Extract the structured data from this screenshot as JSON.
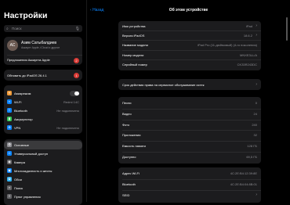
{
  "status_bar": {
    "left": "08:47  вт 20 апр.",
    "dots": "• • •",
    "right": "100%"
  },
  "sidebar": {
    "title": "Настройки",
    "search_placeholder": "Поиск",
    "profile": {
      "initials": "АС",
      "name": "Азим Сатыбалдиев",
      "subtitle": "Аккаунт Apple, iCloud и другое",
      "suggestions": "Предложения Аккаунта Apple",
      "badge": "2"
    },
    "update": {
      "label": "Обновить до iPadOS 26.4.1",
      "badge": "1"
    },
    "connectivity": [
      {
        "label": "Авиарежим",
        "value": "",
        "icon_color": "#f09a37",
        "icon": "airplane-icon",
        "glyph": "✈"
      },
      {
        "label": "Wi-Fi",
        "value": "Redmi 14C",
        "icon_color": "#0a84ff",
        "icon": "wifi-icon",
        "glyph": "≈"
      },
      {
        "label": "Bluetooth",
        "value": "Не подключено",
        "icon_color": "#0a84ff",
        "icon": "bluetooth-icon",
        "glyph": "ᛒ"
      },
      {
        "label": "Аккумулятор",
        "value": "",
        "icon_color": "#34c759",
        "icon": "battery-icon",
        "glyph": "▮"
      },
      {
        "label": "VPN",
        "value": "Не подключено",
        "icon_color": "#0a84ff",
        "icon": "vpn-icon",
        "glyph": "⊕"
      }
    ],
    "general": [
      {
        "label": "Основные",
        "icon_color": "#8e8e93",
        "icon": "gear-icon",
        "glyph": "⚙",
        "selected": true
      },
      {
        "label": "Универсальный доступ",
        "icon_color": "#0a84ff",
        "icon": "accessibility-icon",
        "glyph": "☺",
        "selected": false
      },
      {
        "label": "Камера",
        "icon_color": "#636366",
        "icon": "camera-icon",
        "glyph": "◉",
        "selected": false
      },
      {
        "label": "Многозадачность и жесты",
        "icon_color": "#0a84ff",
        "icon": "multitasking-icon",
        "glyph": "▣",
        "selected": false
      },
      {
        "label": "Обои",
        "icon_color": "#30b0f0",
        "icon": "wallpaper-icon",
        "glyph": "✿",
        "selected": false
      },
      {
        "label": "Поиск",
        "icon_color": "#636366",
        "icon": "search-icon",
        "glyph": "⌕",
        "selected": false
      },
      {
        "label": "Пункт управления",
        "icon_color": "#636366",
        "icon": "control-center-icon",
        "glyph": "≡",
        "selected": false
      }
    ]
  },
  "main": {
    "back_label": "Назад",
    "title": "Об этом устройстве",
    "info": [
      {
        "label": "Имя устройства",
        "value": "iPad",
        "chevron": true
      },
      {
        "label": "Версия iPadOS",
        "value": "18.6.2",
        "chevron": true
      },
      {
        "label": "Название модели",
        "value": "iPad Pro (11-дюймовый) (4-го поколения)",
        "chevron": false
      },
      {
        "label": "Номер модели",
        "value": "MNXE3LL/A",
        "chevron": false
      },
      {
        "label": "Серийный номер",
        "value": "CK33R243DC",
        "chevron": false
      }
    ],
    "coverage": {
      "label": "Срок действия права на сервисное обслуживание истек"
    },
    "stats": [
      {
        "label": "Песни",
        "value": "0"
      },
      {
        "label": "Видео",
        "value": "24"
      },
      {
        "label": "Фото",
        "value": "240"
      },
      {
        "label": "Приложения",
        "value": "32"
      },
      {
        "label": "Емкость памяти",
        "value": "128 ГБ"
      },
      {
        "label": "Доступно",
        "value": "69,5 ГБ"
      }
    ],
    "network": [
      {
        "label": "Адрес Wi-Fi",
        "value": "4C:2E:B4:12:39:8E"
      },
      {
        "label": "Bluetooth",
        "value": "4C:2E:B4:04:8B:01"
      },
      {
        "label": "SEID",
        "value": "",
        "chevron": true
      }
    ]
  }
}
